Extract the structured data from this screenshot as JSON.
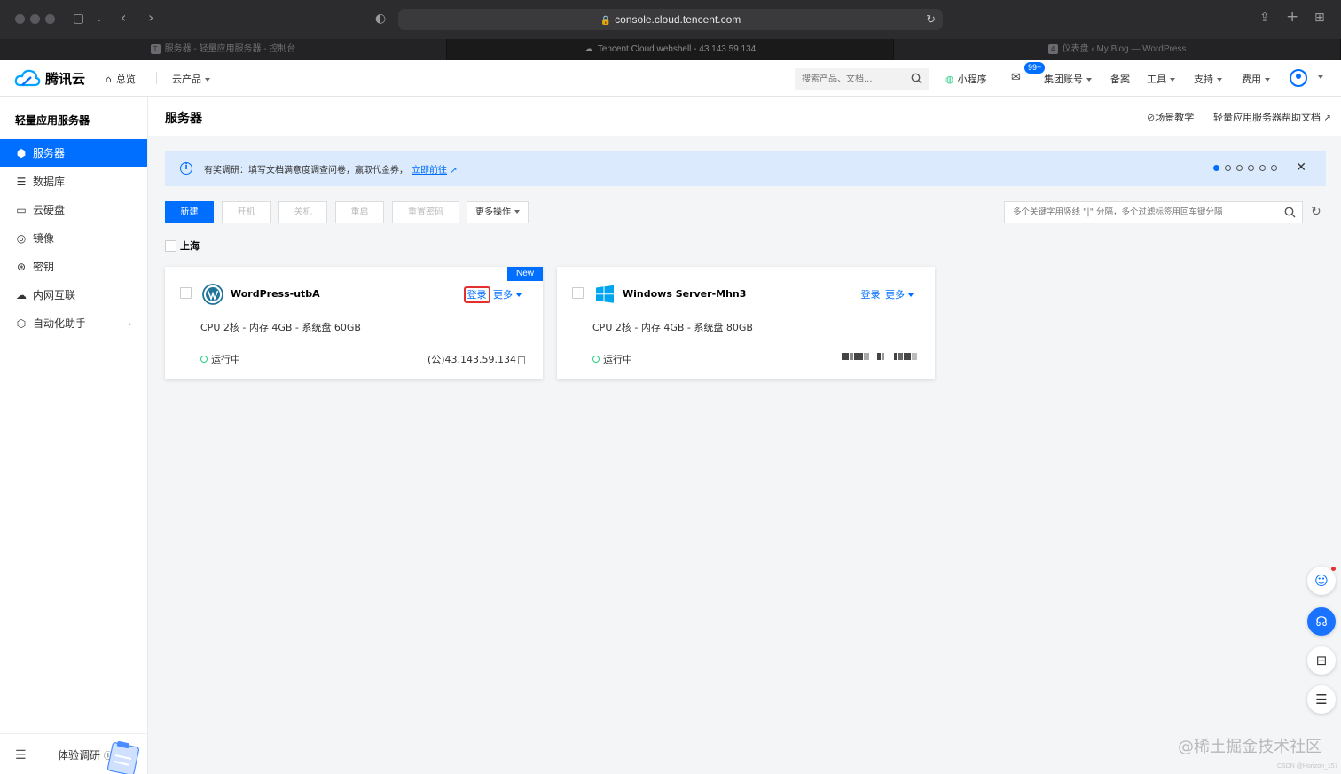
{
  "browser": {
    "url": "console.cloud.tencent.com",
    "tabs": [
      {
        "favicon": "T",
        "title": "服务器 - 轻量应用服务器 - 控制台"
      },
      {
        "favicon": "",
        "title": "Tencent Cloud webshell - 43.143.59.134"
      },
      {
        "favicon": "4",
        "title": "仪表盘 ‹ My Blog — WordPress"
      }
    ]
  },
  "header": {
    "logo_text": "腾讯云",
    "home_label": "总览",
    "products_label": "云产品",
    "search_placeholder": "搜索产品、文档...",
    "miniprogram_label": "小程序",
    "badge_count": "99+",
    "account_label": "集团账号",
    "beian_label": "备案",
    "tools_label": "工具",
    "support_label": "支持",
    "billing_label": "费用"
  },
  "sidebar": {
    "title": "轻量应用服务器",
    "items": [
      {
        "label": "服务器",
        "icon": "server-icon"
      },
      {
        "label": "数据库",
        "icon": "database-icon"
      },
      {
        "label": "云硬盘",
        "icon": "disk-icon"
      },
      {
        "label": "镜像",
        "icon": "image-icon"
      },
      {
        "label": "密钥",
        "icon": "key-icon"
      },
      {
        "label": "内网互联",
        "icon": "network-icon"
      },
      {
        "label": "自动化助手",
        "icon": "automation-icon"
      }
    ],
    "footer_label": "体验调研"
  },
  "page": {
    "title": "服务器",
    "tutorial_link": "场景教学",
    "help_link": "轻量应用服务器帮助文档"
  },
  "notice": {
    "text": "有奖调研：填写文档满意度调查问卷，赢取代金券，",
    "link": "立即前往",
    "dots_total": 6,
    "dots_active": 1
  },
  "toolbar": {
    "new_label": "新建",
    "start_label": "开机",
    "stop_label": "关机",
    "restart_label": "重启",
    "reset_password_label": "重置密码",
    "more_label": "更多操作",
    "filter_placeholder": "多个关键字用竖线 \"|\" 分隔，多个过滤标签用回车键分隔"
  },
  "region": {
    "label": "上海"
  },
  "instances": [
    {
      "name": "WordPress-utbA",
      "os": "wordpress",
      "login_label": "登录",
      "more_label": "更多",
      "spec": "CPU 2核 - 内存 4GB - 系统盘 60GB",
      "status": "运行中",
      "ip": "(公)43.143.59.134",
      "tag": "New"
    },
    {
      "name": "Windows Server-Mhn3",
      "os": "windows",
      "login_label": "登录",
      "more_label": "更多",
      "spec": "CPU 2核 - 内存 4GB - 系统盘 80GB",
      "status": "运行中"
    }
  ],
  "watermark": {
    "main": "@稀土掘金技术社区",
    "small": "CSDN @Horizon_157"
  },
  "colors": {
    "brand": "#006eff",
    "running": "#29cc85",
    "highlight": "#e3302f"
  }
}
